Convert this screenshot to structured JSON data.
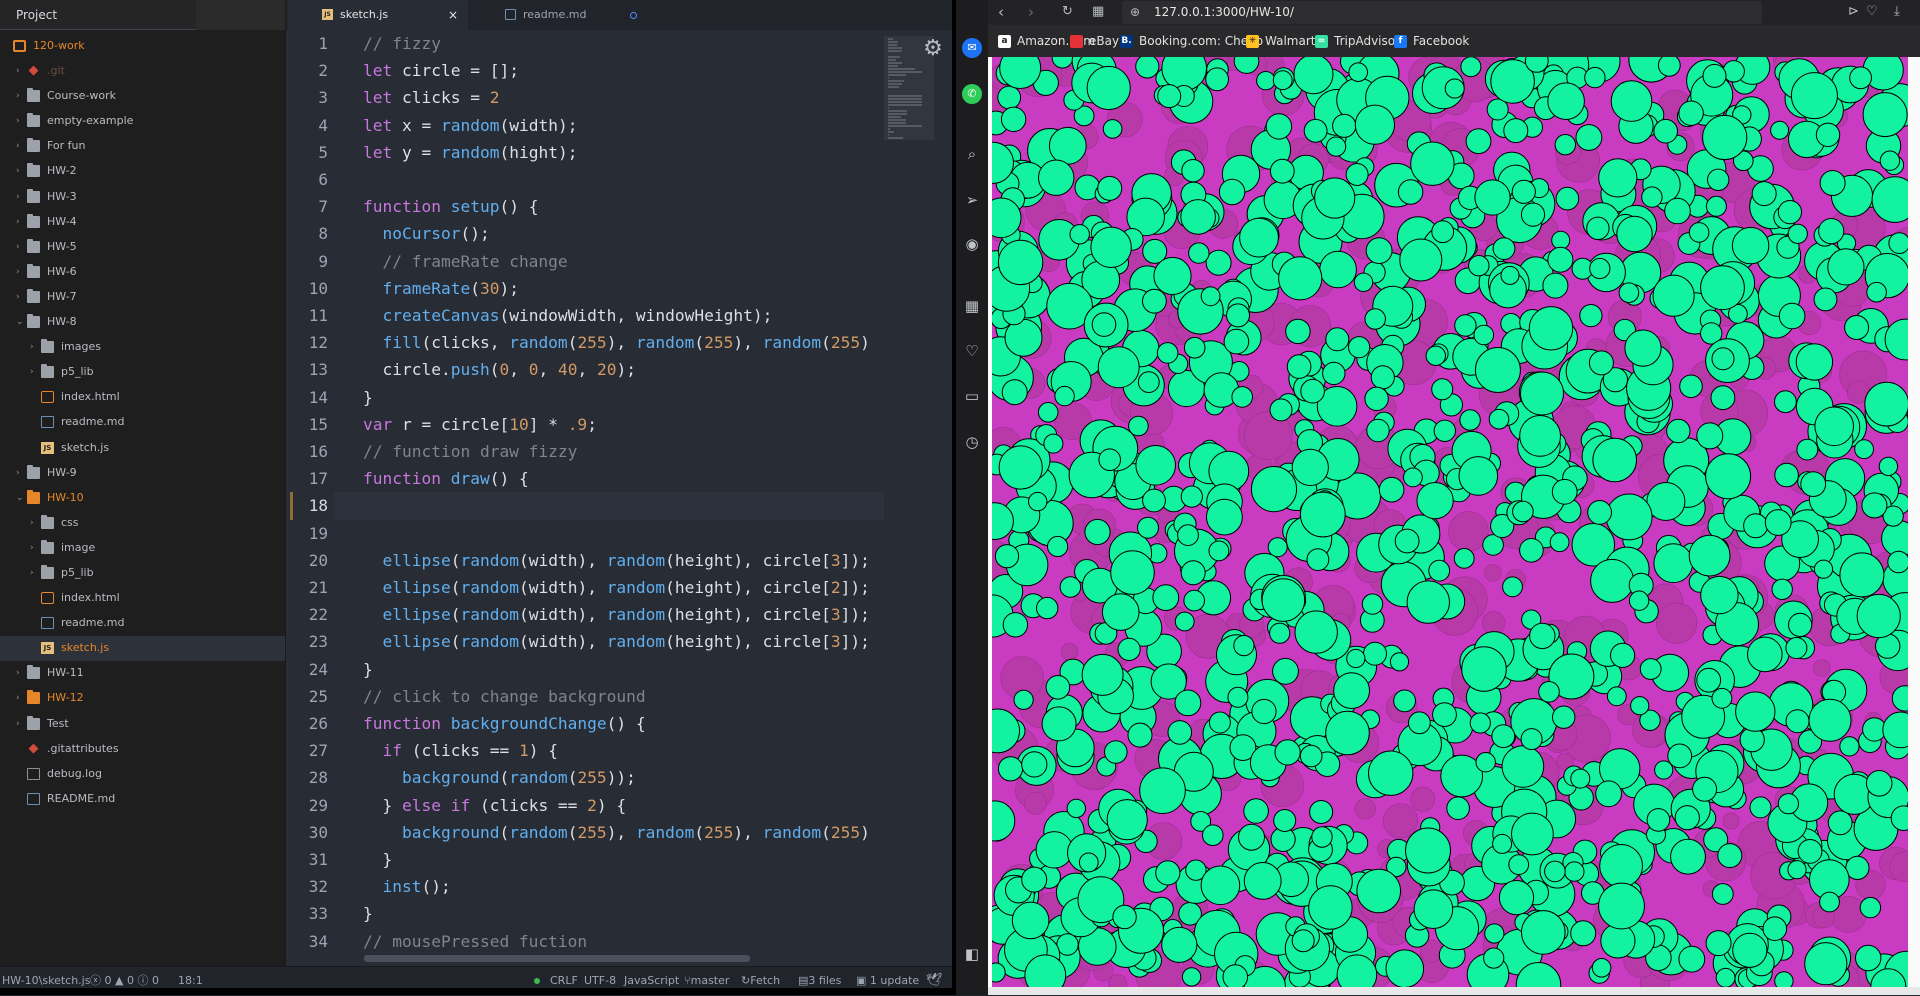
{
  "editor": {
    "project_tab": "Project",
    "tabs": [
      {
        "label": "sketch.js",
        "icon": "js-file-icon",
        "active": true,
        "close": "×"
      },
      {
        "label": "readme.md",
        "icon": "markdown-file-icon",
        "active": false
      }
    ],
    "tree": [
      {
        "label": "120-work",
        "depth": 0,
        "kind": "repo",
        "arrow": "",
        "style": "orange"
      },
      {
        "label": ".git",
        "depth": 1,
        "kind": "git",
        "arrow": "›",
        "style": "dim"
      },
      {
        "label": "Course-work",
        "depth": 1,
        "kind": "folder",
        "arrow": "›"
      },
      {
        "label": "empty-example",
        "depth": 1,
        "kind": "folder",
        "arrow": "›"
      },
      {
        "label": "For fun",
        "depth": 1,
        "kind": "folder",
        "arrow": "›"
      },
      {
        "label": "HW-2",
        "depth": 1,
        "kind": "folder",
        "arrow": "›"
      },
      {
        "label": "HW-3",
        "depth": 1,
        "kind": "folder",
        "arrow": "›"
      },
      {
        "label": "HW-4",
        "depth": 1,
        "kind": "folder",
        "arrow": "›"
      },
      {
        "label": "HW-5",
        "depth": 1,
        "kind": "folder",
        "arrow": "›"
      },
      {
        "label": "HW-6",
        "depth": 1,
        "kind": "folder",
        "arrow": "›"
      },
      {
        "label": "HW-7",
        "depth": 1,
        "kind": "folder",
        "arrow": "›"
      },
      {
        "label": "HW-8",
        "depth": 1,
        "kind": "folder",
        "arrow": "⌄"
      },
      {
        "label": "images",
        "depth": 2,
        "kind": "folder",
        "arrow": "›"
      },
      {
        "label": "p5_lib",
        "depth": 2,
        "kind": "folder",
        "arrow": "›"
      },
      {
        "label": "index.html",
        "depth": 2,
        "kind": "html"
      },
      {
        "label": "readme.md",
        "depth": 2,
        "kind": "md"
      },
      {
        "label": "sketch.js",
        "depth": 2,
        "kind": "js"
      },
      {
        "label": "HW-9",
        "depth": 1,
        "kind": "folder",
        "arrow": "›"
      },
      {
        "label": "HW-10",
        "depth": 1,
        "kind": "folder",
        "arrow": "⌄",
        "style": "orange"
      },
      {
        "label": "css",
        "depth": 2,
        "kind": "folder",
        "arrow": "›"
      },
      {
        "label": "image",
        "depth": 2,
        "kind": "folder",
        "arrow": "›"
      },
      {
        "label": "p5_lib",
        "depth": 2,
        "kind": "folder",
        "arrow": "›"
      },
      {
        "label": "index.html",
        "depth": 2,
        "kind": "html"
      },
      {
        "label": "readme.md",
        "depth": 2,
        "kind": "md"
      },
      {
        "label": "sketch.js",
        "depth": 2,
        "kind": "js",
        "style": "orange",
        "active": true
      },
      {
        "label": "HW-11",
        "depth": 1,
        "kind": "folder",
        "arrow": "›"
      },
      {
        "label": "HW-12",
        "depth": 1,
        "kind": "folder",
        "arrow": "›",
        "style": "orange"
      },
      {
        "label": "Test",
        "depth": 1,
        "kind": "folder",
        "arrow": "›"
      },
      {
        "label": ".gitattributes",
        "depth": 1,
        "kind": "git"
      },
      {
        "label": "debug.log",
        "depth": 1,
        "kind": "log"
      },
      {
        "label": "README.md",
        "depth": 1,
        "kind": "md"
      }
    ],
    "current_line": 18,
    "code_lines": [
      [
        [
          "cm",
          "// fizzy"
        ]
      ],
      [
        [
          "kw",
          "let"
        ],
        [
          "pl",
          " circle = [];"
        ]
      ],
      [
        [
          "kw",
          "let"
        ],
        [
          "pl",
          " clicks = "
        ],
        [
          "nm",
          "2"
        ]
      ],
      [
        [
          "kw",
          "let"
        ],
        [
          "pl",
          " x = "
        ],
        [
          "fn",
          "random"
        ],
        [
          "pl",
          "(width);"
        ]
      ],
      [
        [
          "kw",
          "let"
        ],
        [
          "pl",
          " y = "
        ],
        [
          "fn",
          "random"
        ],
        [
          "pl",
          "(hight);"
        ]
      ],
      [],
      [
        [
          "kw",
          "function"
        ],
        [
          "pl",
          " "
        ],
        [
          "fn",
          "setup"
        ],
        [
          "pl",
          "() {"
        ]
      ],
      [
        [
          "pl",
          "  "
        ],
        [
          "fn",
          "noCursor"
        ],
        [
          "pl",
          "();"
        ]
      ],
      [
        [
          "pl",
          "  "
        ],
        [
          "cm",
          "// frameRate change"
        ]
      ],
      [
        [
          "pl",
          "  "
        ],
        [
          "fn",
          "frameRate"
        ],
        [
          "pl",
          "("
        ],
        [
          "nm",
          "30"
        ],
        [
          "pl",
          ");"
        ]
      ],
      [
        [
          "pl",
          "  "
        ],
        [
          "fn",
          "createCanvas"
        ],
        [
          "pl",
          "(windowWidth, windowHeight);"
        ]
      ],
      [
        [
          "pl",
          "  "
        ],
        [
          "fn",
          "fill"
        ],
        [
          "pl",
          "(clicks, "
        ],
        [
          "fn",
          "random"
        ],
        [
          "pl",
          "("
        ],
        [
          "nm",
          "255"
        ],
        [
          "pl",
          "), "
        ],
        [
          "fn",
          "random"
        ],
        [
          "pl",
          "("
        ],
        [
          "nm",
          "255"
        ],
        [
          "pl",
          "), "
        ],
        [
          "fn",
          "random"
        ],
        [
          "pl",
          "("
        ],
        [
          "nm",
          "255"
        ],
        [
          "pl",
          ")"
        ]
      ],
      [
        [
          "pl",
          "  circle."
        ],
        [
          "fn",
          "push"
        ],
        [
          "pl",
          "("
        ],
        [
          "nm",
          "0"
        ],
        [
          "pl",
          ", "
        ],
        [
          "nm",
          "0"
        ],
        [
          "pl",
          ", "
        ],
        [
          "nm",
          "40"
        ],
        [
          "pl",
          ", "
        ],
        [
          "nm",
          "20"
        ],
        [
          "pl",
          ");"
        ]
      ],
      [
        [
          "pl",
          "}"
        ]
      ],
      [
        [
          "kw",
          "var"
        ],
        [
          "pl",
          " r = circle["
        ],
        [
          "nm",
          "10"
        ],
        [
          "pl",
          "] * "
        ],
        [
          "nm",
          ".9"
        ],
        [
          "pl",
          ";"
        ]
      ],
      [
        [
          "cm",
          "// function draw fizzy"
        ]
      ],
      [
        [
          "kw",
          "function"
        ],
        [
          "pl",
          " "
        ],
        [
          "fn",
          "draw"
        ],
        [
          "pl",
          "() {"
        ]
      ],
      [],
      [],
      [
        [
          "pl",
          "  "
        ],
        [
          "fn",
          "ellipse"
        ],
        [
          "pl",
          "("
        ],
        [
          "fn",
          "random"
        ],
        [
          "pl",
          "(width), "
        ],
        [
          "fn",
          "random"
        ],
        [
          "pl",
          "(height), circle["
        ],
        [
          "nm",
          "3"
        ],
        [
          "pl",
          "]);"
        ]
      ],
      [
        [
          "pl",
          "  "
        ],
        [
          "fn",
          "ellipse"
        ],
        [
          "pl",
          "("
        ],
        [
          "fn",
          "random"
        ],
        [
          "pl",
          "(width), "
        ],
        [
          "fn",
          "random"
        ],
        [
          "pl",
          "(height), circle["
        ],
        [
          "nm",
          "2"
        ],
        [
          "pl",
          "]);"
        ]
      ],
      [
        [
          "pl",
          "  "
        ],
        [
          "fn",
          "ellipse"
        ],
        [
          "pl",
          "("
        ],
        [
          "fn",
          "random"
        ],
        [
          "pl",
          "(width), "
        ],
        [
          "fn",
          "random"
        ],
        [
          "pl",
          "(height), circle["
        ],
        [
          "nm",
          "3"
        ],
        [
          "pl",
          "]);"
        ]
      ],
      [
        [
          "pl",
          "  "
        ],
        [
          "fn",
          "ellipse"
        ],
        [
          "pl",
          "("
        ],
        [
          "fn",
          "random"
        ],
        [
          "pl",
          "(width), "
        ],
        [
          "fn",
          "random"
        ],
        [
          "pl",
          "(height), circle["
        ],
        [
          "nm",
          "3"
        ],
        [
          "pl",
          "]);"
        ]
      ],
      [
        [
          "pl",
          "}"
        ]
      ],
      [
        [
          "cm",
          "// click to change background"
        ]
      ],
      [
        [
          "kw",
          "function"
        ],
        [
          "pl",
          " "
        ],
        [
          "fn",
          "backgroundChange"
        ],
        [
          "pl",
          "() {"
        ]
      ],
      [
        [
          "pl",
          "  "
        ],
        [
          "kw",
          "if"
        ],
        [
          "pl",
          " (clicks == "
        ],
        [
          "nm",
          "1"
        ],
        [
          "pl",
          ") {"
        ]
      ],
      [
        [
          "pl",
          "    "
        ],
        [
          "fn",
          "background"
        ],
        [
          "pl",
          "("
        ],
        [
          "fn",
          "random"
        ],
        [
          "pl",
          "("
        ],
        [
          "nm",
          "255"
        ],
        [
          "pl",
          "));"
        ]
      ],
      [
        [
          "pl",
          "  } "
        ],
        [
          "kw",
          "else if"
        ],
        [
          "pl",
          " (clicks == "
        ],
        [
          "nm",
          "2"
        ],
        [
          "pl",
          ") {"
        ]
      ],
      [
        [
          "pl",
          "    "
        ],
        [
          "fn",
          "background"
        ],
        [
          "pl",
          "("
        ],
        [
          "fn",
          "random"
        ],
        [
          "pl",
          "("
        ],
        [
          "nm",
          "255"
        ],
        [
          "pl",
          "), "
        ],
        [
          "fn",
          "random"
        ],
        [
          "pl",
          "("
        ],
        [
          "nm",
          "255"
        ],
        [
          "pl",
          "), "
        ],
        [
          "fn",
          "random"
        ],
        [
          "pl",
          "("
        ],
        [
          "nm",
          "255"
        ],
        [
          "pl",
          ")"
        ]
      ],
      [
        [
          "pl",
          "  }"
        ]
      ],
      [
        [
          "pl",
          "  "
        ],
        [
          "fn",
          "inst"
        ],
        [
          "pl",
          "();"
        ]
      ],
      [
        [
          "pl",
          "}"
        ]
      ],
      [
        [
          "cm",
          "// mousePressed fuction"
        ]
      ]
    ],
    "status": {
      "path": "HW-10\\sketch.js",
      "errors": "0",
      "warnings": "0",
      "infos": "0",
      "cursor": "18:1",
      "line_ending": "CRLF",
      "encoding": "UTF-8",
      "grammar": "JavaScript",
      "branch": "master",
      "fetch": "Fetch",
      "files": "3 files",
      "update": "1 update"
    }
  },
  "browser": {
    "url": "127.0.0.1:3000/HW-10/",
    "bookmarks": [
      {
        "label": "Amazon.com",
        "icon": "amazon-icon",
        "color": "#ffffff",
        "glyph": "a"
      },
      {
        "label": "eBay",
        "icon": "ebay-icon",
        "color": "#e53238",
        "glyph": ""
      },
      {
        "label": "Booking.com: Cheap",
        "icon": "booking-icon",
        "color": "#003580",
        "glyph": "B."
      },
      {
        "label": "Walmart",
        "icon": "walmart-icon",
        "color": "#ffc220",
        "glyph": "✳"
      },
      {
        "label": "TripAdvisor",
        "icon": "tripadvisor-icon",
        "color": "#34e0a1",
        "glyph": "∞"
      },
      {
        "label": "Facebook",
        "icon": "facebook-icon",
        "color": "#1877f2",
        "glyph": "f"
      }
    ],
    "sidebar_icons": [
      "messenger-icon",
      "whatsapp-icon",
      "search-icon",
      "send-icon",
      "camera-icon",
      "extensions-icon",
      "heart-icon",
      "reading-list-icon",
      "history-icon",
      "panel-toggle-icon"
    ],
    "canvas": {
      "background": "#c93bc1",
      "fill_color": "#12f29f",
      "stroke_color": "#000000",
      "ghost_color": "#b83aa8"
    }
  }
}
